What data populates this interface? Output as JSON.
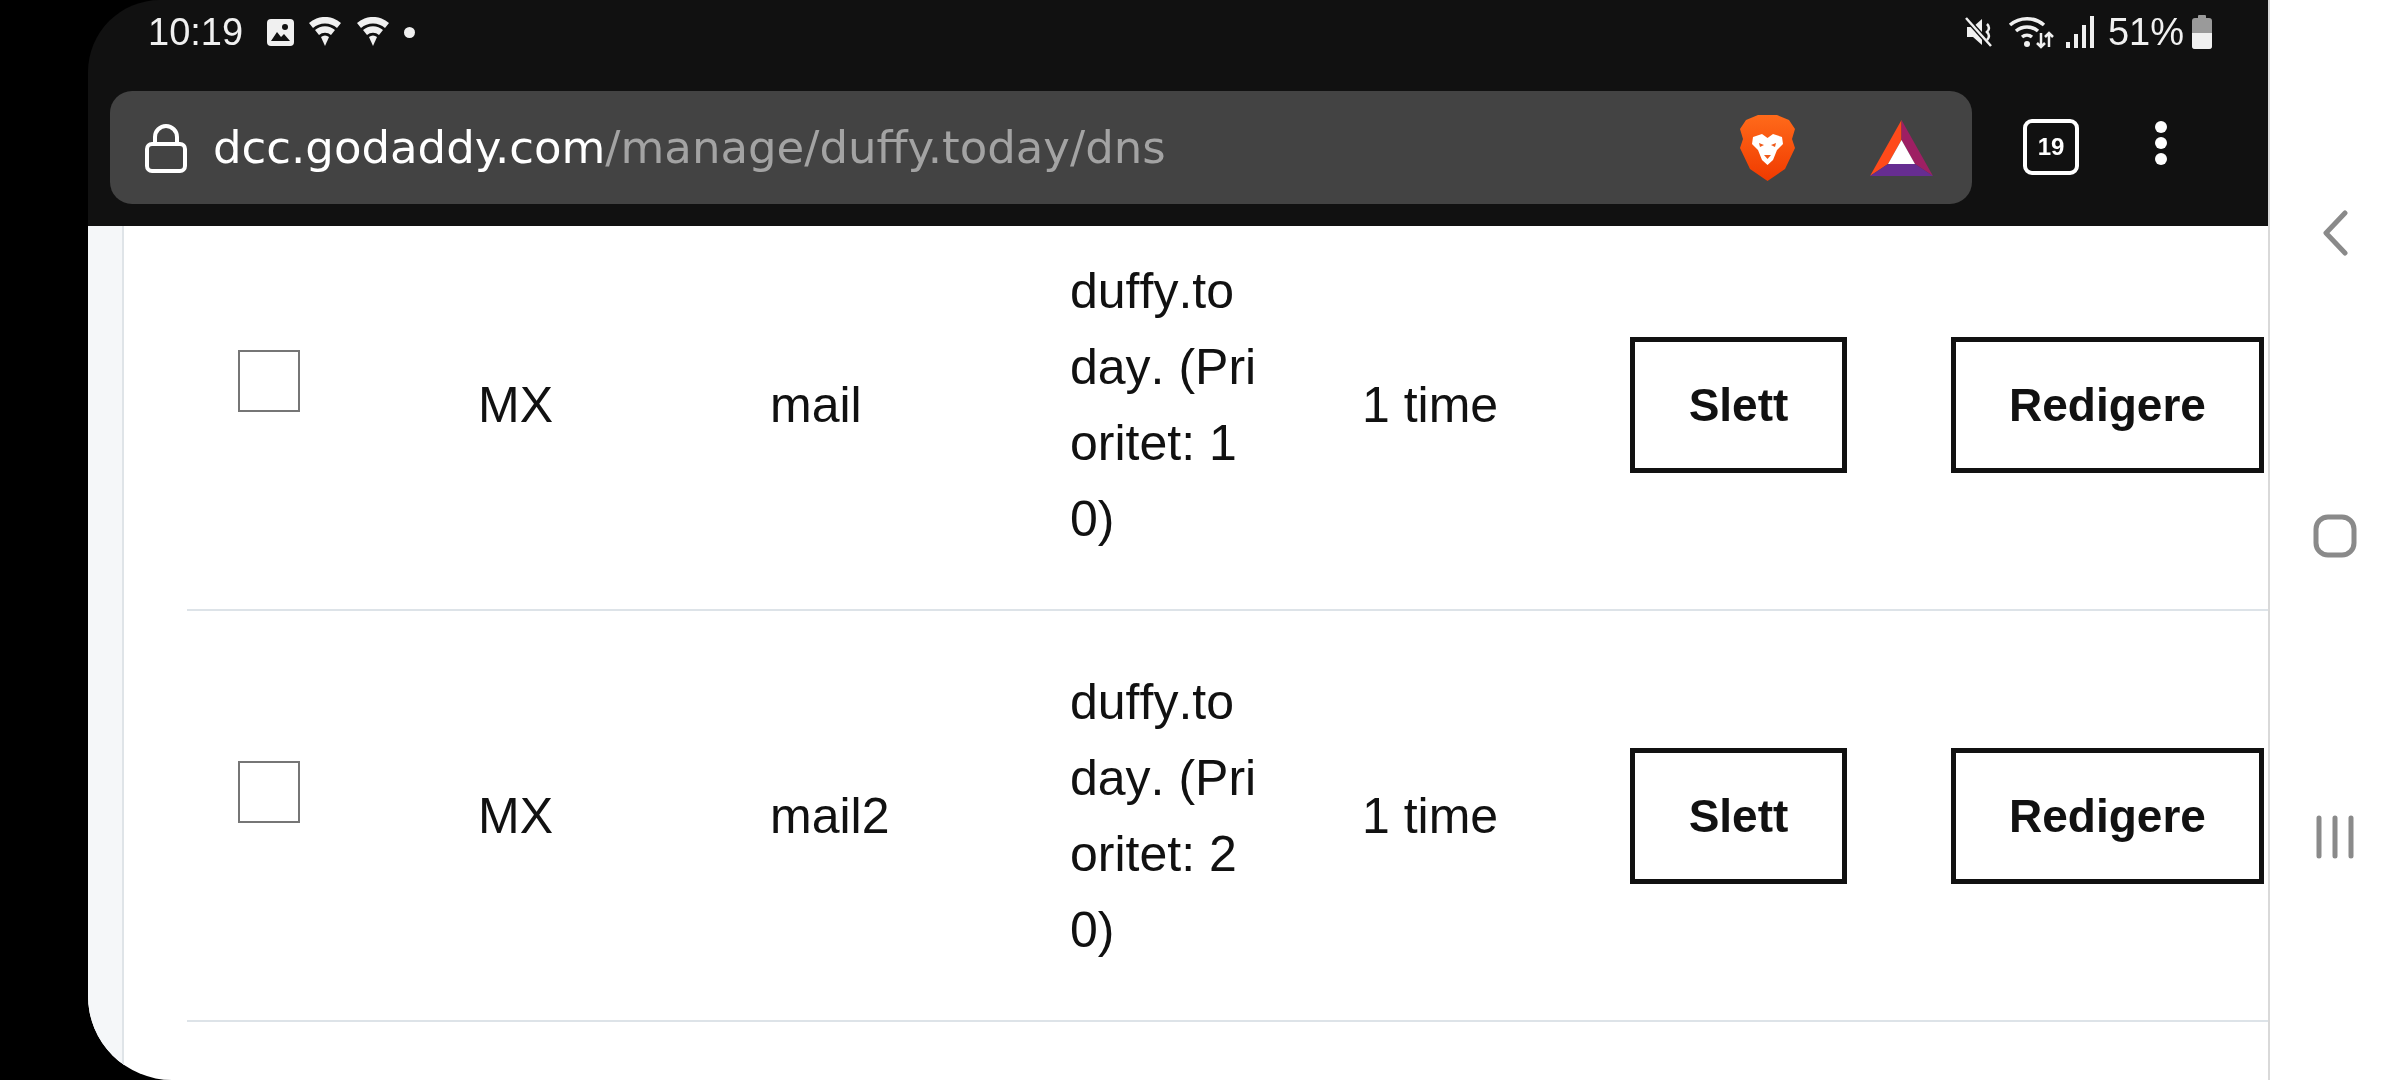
{
  "status_bar": {
    "time": "10:19",
    "battery": "51%"
  },
  "browser": {
    "url_host": "dcc.godaddy.com",
    "url_path": "/manage/duffy.today/dns",
    "tab_count": "19"
  },
  "dns_records": [
    {
      "checked": false,
      "type": "MX",
      "name": "mail",
      "value": "duffy.today. (Prioritet: 10)",
      "ttl": "1 time",
      "delete_button": "Slett",
      "edit_button": "Redigere"
    },
    {
      "checked": false,
      "type": "MX",
      "name": "mail2",
      "value": "duffy.today. (Prioritet: 20)",
      "ttl": "1 time",
      "delete_button": "Slett",
      "edit_button": "Redigere"
    }
  ]
}
